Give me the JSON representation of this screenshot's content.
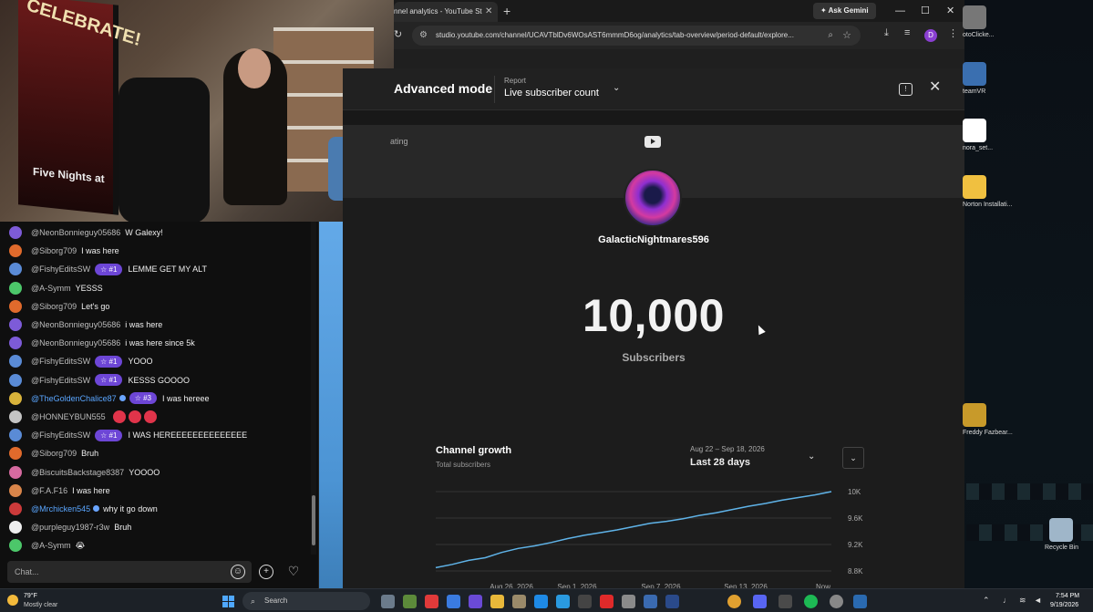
{
  "webcam": {
    "poster_top": "CELEBRATE!",
    "poster_bottom": "Five Nights at"
  },
  "chat": {
    "messages": [
      {
        "author": "@NeonBonnieguy05686",
        "badge": "",
        "text": "W Galexy!",
        "color": "#7d5bd8"
      },
      {
        "author": "@Siborg709",
        "badge": "",
        "text": "I was here",
        "color": "#e06a2c"
      },
      {
        "author": "@FishyEditsSW",
        "badge": "☆ #1",
        "text": "LEMME GET MY ALT",
        "color": "#5a8bd6"
      },
      {
        "author": "@A-Symm",
        "badge": "",
        "text": "YESSS",
        "color": "#4cc76a"
      },
      {
        "author": "@Siborg709",
        "badge": "",
        "text": "Let's go",
        "color": "#e06a2c"
      },
      {
        "author": "@NeonBonnieguy05686",
        "badge": "",
        "text": "i was here",
        "color": "#7d5bd8"
      },
      {
        "author": "@NeonBonnieguy05686",
        "badge": "",
        "text": "i was here since 5k",
        "color": "#7d5bd8"
      },
      {
        "author": "@FishyEditsSW",
        "badge": "☆ #1",
        "text": "YOOO",
        "color": "#5a8bd6"
      },
      {
        "author": "@FishyEditsSW",
        "badge": "☆ #1",
        "text": "KESSS GOOOO",
        "color": "#5a8bd6"
      },
      {
        "author": "@TheGoldenChalice87",
        "badge": "☆ #3",
        "text": "I was hereee",
        "color": "#d9b33b",
        "blue": true,
        "verified": true
      },
      {
        "author": "@HONNEYBUN555",
        "badge": "",
        "text": "",
        "color": "#c4c4c4",
        "emotes": 3
      },
      {
        "author": "@FishyEditsSW",
        "badge": "☆ #1",
        "text": "I WAS HEREEEEEEEEEEEEEE",
        "color": "#5a8bd6"
      },
      {
        "author": "@Siborg709",
        "badge": "",
        "text": "Bruh",
        "color": "#e06a2c"
      },
      {
        "author": "@BiscuitsBackstage8387",
        "badge": "",
        "text": "YOOOO",
        "color": "#d66aa0"
      },
      {
        "author": "@F.A.F16",
        "badge": "",
        "text": "I was here",
        "color": "#d9854a"
      },
      {
        "author": "@Mrchicken545",
        "badge": "",
        "text": "why it go down",
        "color": "#cc3a3a",
        "blue": true,
        "verified": true
      },
      {
        "author": "@purpleguy1987-r3w",
        "badge": "",
        "text": "Bruh",
        "color": "#eeeeee"
      },
      {
        "author": "@A-Symm",
        "badge": "",
        "text": "😭",
        "color": "#4cc76a"
      }
    ],
    "input_placeholder": "Chat..."
  },
  "browser": {
    "tab_title": "nnel analytics - YouTube St",
    "tab_close": "✕",
    "new_tab": "+",
    "ask_gemini": "✦ Ask Gemini",
    "minimize": "—",
    "maximize": "☐",
    "close": "✕",
    "url": "studio.youtube.com/channel/UCAVTblDv6WOsAST6mmmD6og/analytics/tab-overview/period-default/explore...",
    "profile_initial": "D"
  },
  "studio": {
    "advanced_mode": "Advanced mode",
    "report_label": "Report",
    "report_value": "Live subscriber count",
    "dating": "ating",
    "channel_name": "GalacticNightmares596",
    "subscriber_count": "10,000",
    "subscriber_label": "Subscribers",
    "growth_title": "Channel growth",
    "growth_subtitle": "Total subscribers",
    "range_label": "Aug 22 – Sep 18, 2026",
    "range_value": "Last 28 days"
  },
  "chart_data": {
    "type": "line",
    "title": "Channel growth",
    "subtitle": "Total subscribers",
    "x_ticks": [
      "Aug 26, 2026",
      "Sep 1, 2026",
      "Sep 7, 2026",
      "Sep 13, 2026",
      "Now"
    ],
    "y_ticks": [
      "8.8K",
      "9.2K",
      "9.6K",
      "10K"
    ],
    "ylim": [
      8800,
      10000
    ],
    "series": [
      {
        "values": [
          8850,
          8900,
          8960,
          9000,
          9080,
          9140,
          9180,
          9230,
          9290,
          9340,
          9380,
          9420,
          9470,
          9520,
          9550,
          9590,
          9640,
          9680,
          9730,
          9780,
          9820,
          9870,
          9910,
          9950,
          10000
        ]
      }
    ],
    "line_color": "#5fb3e8",
    "grid": true
  },
  "desktop": {
    "icons": [
      {
        "label": "otoClicke...",
        "color": "#777"
      },
      {
        "label": "teamVR",
        "color": "#3a6fb0"
      },
      {
        "label": "nora_set...",
        "color": "#ffffff"
      },
      {
        "label": "Norton Installati...",
        "color": "#f0c040"
      },
      {
        "label": "Freddy Fazbear...",
        "color": "#c89a2a"
      },
      {
        "label": "Recycle Bin",
        "color": "#9fb6c9"
      }
    ]
  },
  "taskbar": {
    "temp": "79°F",
    "weather": "Mostly clear",
    "search": "Search",
    "time": "7:54 PM",
    "date": "9/19/2026"
  }
}
